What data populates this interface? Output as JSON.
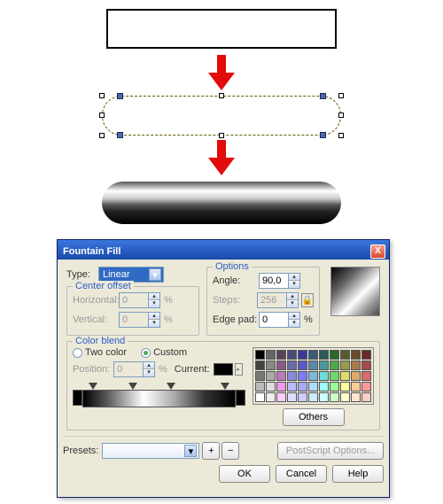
{
  "dialog": {
    "title": "Fountain Fill",
    "type_label": "Type:",
    "type_value": "Linear",
    "center_offset": {
      "title": "Center offset",
      "horizontal_label": "Horizontal:",
      "horizontal_value": "0",
      "horizontal_unit": "%",
      "vertical_label": "Vertical:",
      "vertical_value": "0",
      "vertical_unit": "%"
    },
    "options": {
      "title": "Options",
      "angle_label": "Angle:",
      "angle_value": "90,0",
      "steps_label": "Steps:",
      "steps_value": "256",
      "edgepad_label": "Edge pad:",
      "edgepad_value": "0",
      "edgepad_unit": "%"
    },
    "color_blend": {
      "title": "Color blend",
      "two_color_label": "Two color",
      "custom_label": "Custom",
      "position_label": "Position:",
      "position_value": "0",
      "position_unit": "%",
      "current_label": "Current:",
      "others_btn": "Others"
    },
    "presets": {
      "label": "Presets:",
      "value": ""
    },
    "postscript_btn": "PostScript Options...",
    "ok_btn": "OK",
    "cancel_btn": "Cancel",
    "help_btn": "Help",
    "close_x": "X"
  },
  "palette_colors": [
    "#000000",
    "#666666",
    "#5a435a",
    "#4a4a7a",
    "#3a3a99",
    "#3a5a7a",
    "#2a5a5a",
    "#2a6a2a",
    "#5a5a2a",
    "#6a4a2a",
    "#6a2a2a",
    "#444444",
    "#888888",
    "#8a5a8a",
    "#6a6aaa",
    "#5a5acc",
    "#5a8aaa",
    "#4a9a9a",
    "#4aaa4a",
    "#9a9a4a",
    "#aa7a4a",
    "#aa4a4a",
    "#777777",
    "#aaaaaa",
    "#bb7abb",
    "#8a8add",
    "#7a7aff",
    "#7abadd",
    "#6adddd",
    "#6add6a",
    "#dddd6a",
    "#ddaa6a",
    "#dd6a6a",
    "#bbbbbb",
    "#dddddd",
    "#ee9aee",
    "#babafc",
    "#aaaaff",
    "#aaddff",
    "#99ffff",
    "#99ff99",
    "#ffff99",
    "#ffcc99",
    "#ff9999",
    "#ffffff",
    "#eeeeee",
    "#ffccff",
    "#ddddff",
    "#ccccff",
    "#cceeff",
    "#ccffff",
    "#ccffcc",
    "#ffffcc",
    "#ffe6cc",
    "#ffcccc"
  ]
}
